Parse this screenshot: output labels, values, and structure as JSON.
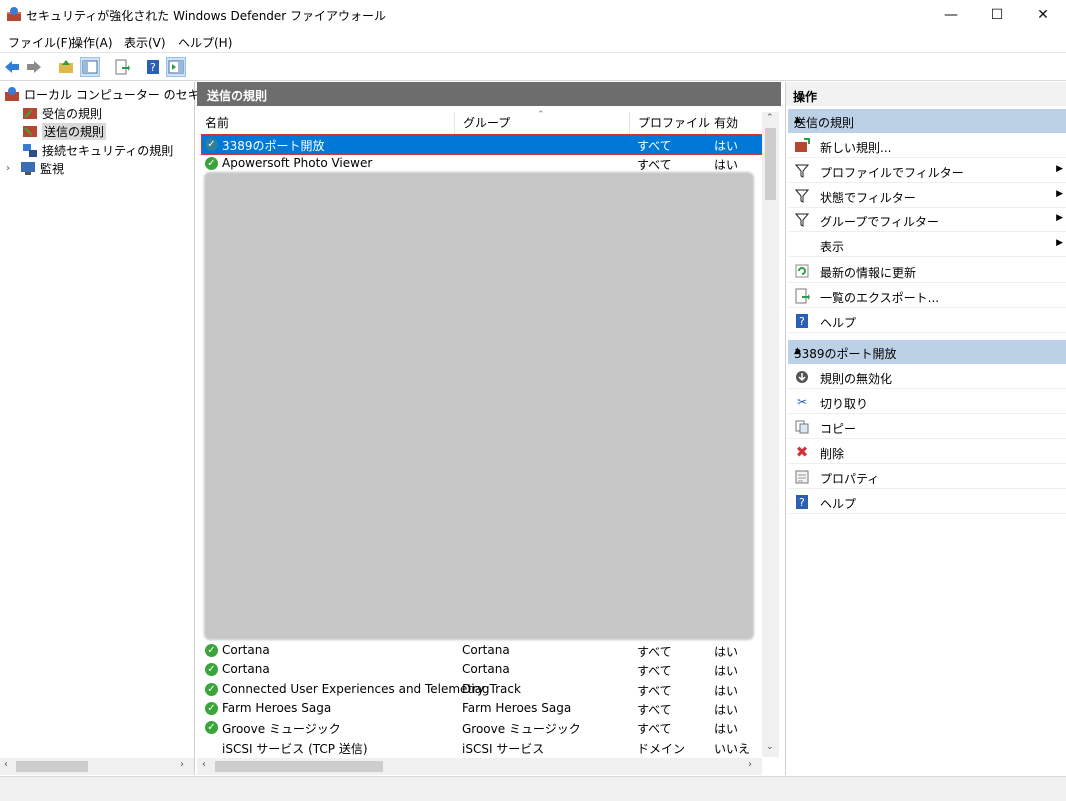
{
  "window": {
    "title": "セキュリティが強化された Windows Defender ファイアウォール",
    "minimize": "—",
    "maximize": "☐",
    "close": "✕"
  },
  "menu": [
    "ファイル(F)",
    "操作(A)",
    "表示(V)",
    "ヘルプ(H)"
  ],
  "toolbar": {
    "icons": [
      "back-icon",
      "forward-icon",
      "up-folder-icon",
      "show-hide-tree-icon",
      "export-icon",
      "help-icon",
      "show-action-pane-icon"
    ]
  },
  "tree": {
    "root": "ローカル コンピューター のセキュリティが",
    "items": [
      {
        "label": "受信の規則",
        "selected": false
      },
      {
        "label": "送信の規則",
        "selected": true
      },
      {
        "label": "接続セキュリティの規則",
        "selected": false
      },
      {
        "label": "監視",
        "selected": false,
        "expandable": true
      }
    ]
  },
  "center": {
    "header": "送信の規則",
    "columns": [
      "名前",
      "グループ",
      "プロファイル",
      "有効"
    ],
    "rows_top": [
      {
        "name": "3389のポート開放",
        "group": "",
        "profile": "すべて",
        "enabled": "はい",
        "selected": true
      },
      {
        "name": "Apowersoft Photo Viewer",
        "group": "",
        "profile": "すべて",
        "enabled": "はい",
        "selected": false
      }
    ],
    "rows_bottom": [
      {
        "name": "Cortana",
        "group": "Cortana",
        "profile": "すべて",
        "enabled": "はい",
        "icon": true
      },
      {
        "name": "Cortana",
        "group": "Cortana",
        "profile": "すべて",
        "enabled": "はい",
        "icon": true
      },
      {
        "name": "Connected User Experiences and Telemetry",
        "group": "DiagTrack",
        "profile": "すべて",
        "enabled": "はい",
        "icon": true
      },
      {
        "name": "Farm Heroes Saga",
        "group": "Farm Heroes Saga",
        "profile": "すべて",
        "enabled": "はい",
        "icon": true
      },
      {
        "name": "Groove ミュージック",
        "group": "Groove ミュージック",
        "profile": "すべて",
        "enabled": "はい",
        "icon": true
      },
      {
        "name": "iSCSI サービス (TCP 送信)",
        "group": "iSCSI サービス",
        "profile": "ドメイン",
        "enabled": "いいえ",
        "icon": false
      }
    ]
  },
  "actions": {
    "header": "操作",
    "section1": {
      "title": "送信の規則",
      "items": [
        {
          "label": "新しい規則...",
          "icon": "new-rule-icon",
          "submenu": false
        },
        {
          "label": "プロファイルでフィルター",
          "icon": "filter-icon",
          "submenu": true
        },
        {
          "label": "状態でフィルター",
          "icon": "filter-icon",
          "submenu": true
        },
        {
          "label": "グループでフィルター",
          "icon": "filter-icon",
          "submenu": true
        },
        {
          "label": "表示",
          "icon": "",
          "submenu": true
        },
        {
          "label": "最新の情報に更新",
          "icon": "refresh-icon",
          "submenu": false
        },
        {
          "label": "一覧のエクスポート...",
          "icon": "export-icon",
          "submenu": false
        },
        {
          "label": "ヘルプ",
          "icon": "help-icon",
          "submenu": false
        }
      ]
    },
    "section2": {
      "title": "3389のポート開放",
      "items": [
        {
          "label": "規則の無効化",
          "icon": "disable-rule-icon"
        },
        {
          "label": "切り取り",
          "icon": "cut-icon"
        },
        {
          "label": "コピー",
          "icon": "copy-icon"
        },
        {
          "label": "削除",
          "icon": "delete-icon"
        },
        {
          "label": "プロパティ",
          "icon": "properties-icon"
        },
        {
          "label": "ヘルプ",
          "icon": "help-icon"
        }
      ]
    }
  },
  "colors": {
    "selection": "#0078d7",
    "selection_outline": "#d13438",
    "section_header": "#bdd1e6",
    "pane_header": "#6d6d6d",
    "ok_green": "#3aa53a"
  }
}
